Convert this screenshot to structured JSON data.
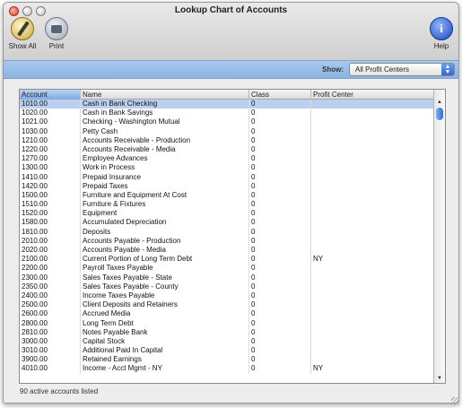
{
  "window": {
    "title": "Lookup Chart of Accounts"
  },
  "toolbar": {
    "show_all_label": "Show All",
    "print_label": "Print",
    "help_label": "Help",
    "help_glyph": "i"
  },
  "filter": {
    "label": "Show:",
    "value": "All Profit Centers"
  },
  "table": {
    "headers": [
      "Account",
      "Name",
      "Class",
      "Profit Center"
    ],
    "rows": [
      [
        "1010.00",
        "Cash in Bank Checking",
        "0",
        ""
      ],
      [
        "1020.00",
        "Cash in Bank Savings",
        "0",
        ""
      ],
      [
        "1021.00",
        "Checking - Washington Mutual",
        "0",
        ""
      ],
      [
        "1030.00",
        "Petty Cash",
        "0",
        ""
      ],
      [
        "1210.00",
        "Accounts Receivable - Production",
        "0",
        ""
      ],
      [
        "1220.00",
        "Accounts Receivable - Media",
        "0",
        ""
      ],
      [
        "1270.00",
        "Employee Advances",
        "0",
        ""
      ],
      [
        "1300.00",
        "Work in Process",
        "0",
        ""
      ],
      [
        "1410.00",
        "Prepaid Insurance",
        "0",
        ""
      ],
      [
        "1420.00",
        "Prepaid Taxes",
        "0",
        ""
      ],
      [
        "1500.00",
        "Furniture and Equipment At Cost",
        "0",
        ""
      ],
      [
        "1510.00",
        "Furniture & Fixtures",
        "0",
        ""
      ],
      [
        "1520.00",
        "Equipment",
        "0",
        ""
      ],
      [
        "1580.00",
        "Accumulated Depreciation",
        "0",
        ""
      ],
      [
        "1810.00",
        "Deposits",
        "0",
        ""
      ],
      [
        "2010.00",
        "Accounts Payable - Production",
        "0",
        ""
      ],
      [
        "2020.00",
        "Accounts Payable - Media",
        "0",
        ""
      ],
      [
        "2100.00",
        "Current Portion of Long Term Debt",
        "0",
        "NY"
      ],
      [
        "2200.00",
        "Payroll Taxes Payable",
        "0",
        ""
      ],
      [
        "2300.00",
        "Sales Taxes Payable - State",
        "0",
        ""
      ],
      [
        "2350.00",
        "Sales Taxes Payable - County",
        "0",
        ""
      ],
      [
        "2400.00",
        "Income Taxes Payable",
        "0",
        ""
      ],
      [
        "2500.00",
        "Client Deposits and Retainers",
        "0",
        ""
      ],
      [
        "2600.00",
        "Accrued Media",
        "0",
        ""
      ],
      [
        "2800.00",
        "Long Term Debt",
        "0",
        ""
      ],
      [
        "2810.00",
        "Notes Payable Bank",
        "0",
        ""
      ],
      [
        "3000.00",
        "Capital Stock",
        "0",
        ""
      ],
      [
        "3010.00",
        "Additional Paid In Capital",
        "0",
        ""
      ],
      [
        "3900.00",
        "Retained Earnings",
        "0",
        ""
      ],
      [
        "4010.00",
        "Income - Acct Mgmt - NY",
        "0",
        "NY"
      ]
    ],
    "selected_row": 0
  },
  "status": {
    "text": "90 active accounts listed"
  }
}
